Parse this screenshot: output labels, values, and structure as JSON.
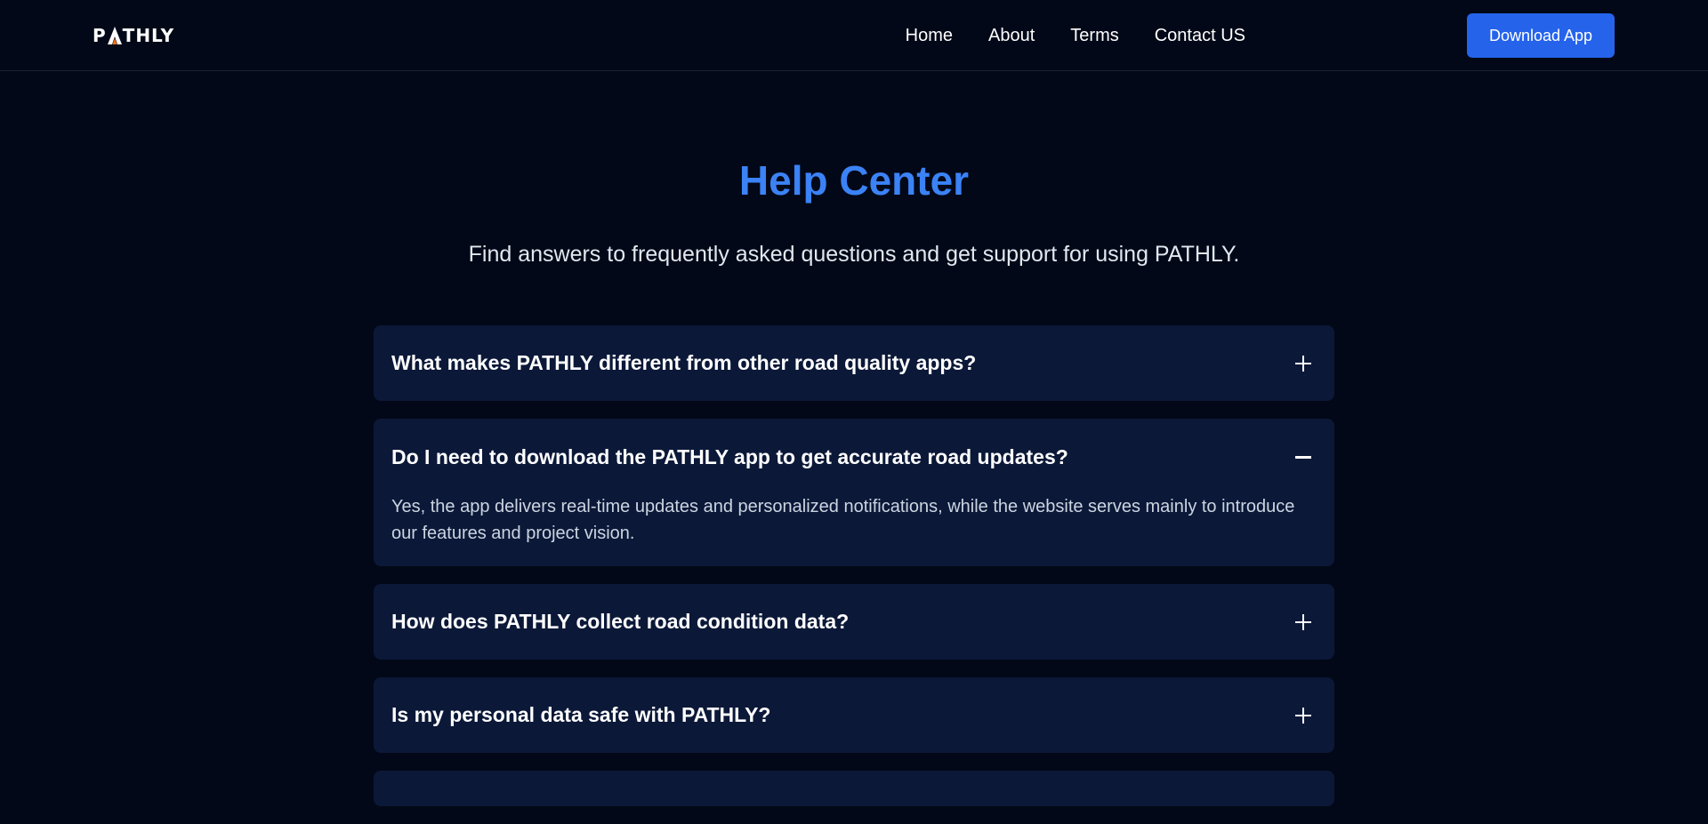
{
  "nav": {
    "logo": "PATHLY",
    "links": [
      "Home",
      "About",
      "Terms",
      "Contact US"
    ],
    "cta": "Download App"
  },
  "hero": {
    "title": "Help Center",
    "subtitle": "Find answers to frequently asked questions and get support for using PATHLY."
  },
  "faqs": [
    {
      "question": "What makes PATHLY different from other road quality apps?",
      "toggle": "plus",
      "answer": ""
    },
    {
      "question": "Do I need to download the PATHLY app to get accurate road updates?",
      "toggle": "minus",
      "answer": "Yes, the app delivers real-time updates and personalized notifications, while the website serves mainly to introduce our features and project vision."
    },
    {
      "question": "How does PATHLY collect road condition data?",
      "toggle": "plus",
      "answer": ""
    },
    {
      "question": "Is my personal data safe with PATHLY?",
      "toggle": "plus",
      "answer": ""
    }
  ],
  "colors": {
    "background": "#020817",
    "accent": "#3b82f6",
    "button": "#2563eb",
    "card": "#0b1838",
    "logo_accent": "#f97316"
  }
}
